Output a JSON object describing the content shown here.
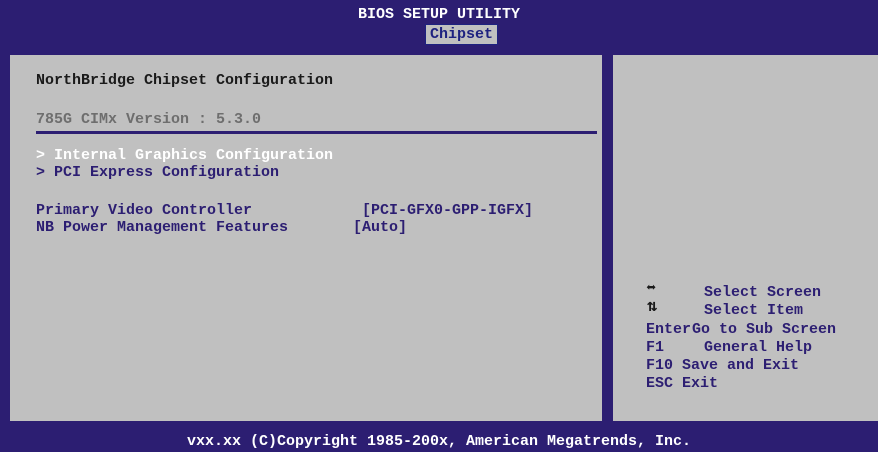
{
  "header": {
    "title": "BIOS SETUP UTILITY",
    "active_tab": "Chipset"
  },
  "main": {
    "heading": "NorthBridge Chipset Configuration",
    "version": "785G CIMx Version : 5.3.0",
    "submenus": [
      "> Internal Graphics Configuration",
      "> PCI Express Configuration"
    ],
    "options": [
      {
        "label": "Primary Video Controller",
        "value": "[PCI-GFX0-GPP-IGFX]"
      },
      {
        "label": "NB Power Management Features",
        "value": "[Auto]"
      }
    ]
  },
  "help": {
    "keys": [
      {
        "key": "",
        "icon": "left-right-arrow-icon",
        "desc": "Select Screen"
      },
      {
        "key": "",
        "icon": "up-down-arrow-icon",
        "desc": "Select Item"
      },
      {
        "key": "Enter",
        "desc": "Go to Sub Screen"
      },
      {
        "key": "F1",
        "desc": "General Help"
      },
      {
        "key": "F10",
        "desc": "Save and Exit"
      },
      {
        "key": "ESC",
        "desc": "Exit"
      }
    ]
  },
  "footer": {
    "copyright": "vxx.xx (C)Copyright 1985-200x, American Megatrends, Inc."
  },
  "colors": {
    "bios_blue": "#2c1e72",
    "panel_gray": "#c0c0c0",
    "selected_text": "#ffffff",
    "disabled_text": "#6e6e6e"
  }
}
